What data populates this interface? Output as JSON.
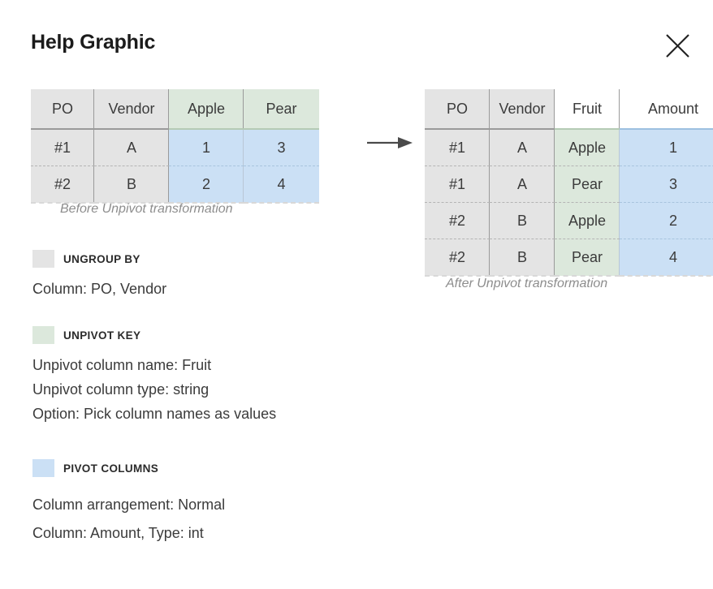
{
  "header": {
    "title": "Help Graphic",
    "close_label": "Close"
  },
  "before_table": {
    "caption": "Before Unpivot transformation",
    "columns": [
      {
        "label": "PO",
        "group": "ungroup"
      },
      {
        "label": "Vendor",
        "group": "ungroup"
      },
      {
        "label": "Apple",
        "group": "key"
      },
      {
        "label": "Pear",
        "group": "key"
      }
    ],
    "rows": [
      [
        "#1",
        "A",
        "1",
        "3"
      ],
      [
        "#2",
        "B",
        "2",
        "4"
      ]
    ]
  },
  "after_table": {
    "caption": "After Unpivot transformation",
    "columns": [
      {
        "label": "PO",
        "group": "ungroup"
      },
      {
        "label": "Vendor",
        "group": "ungroup"
      },
      {
        "label": "Fruit",
        "group": "key"
      },
      {
        "label": "Amount",
        "group": "pivot"
      }
    ],
    "rows": [
      [
        "#1",
        "A",
        "Apple",
        "1"
      ],
      [
        "#1",
        "A",
        "Pear",
        "3"
      ],
      [
        "#2",
        "B",
        "Apple",
        "2"
      ],
      [
        "#2",
        "B",
        "Pear",
        "4"
      ]
    ]
  },
  "transform_arrow": "arrow-right",
  "legend": [
    {
      "title": "UNGROUP BY",
      "color": "#e4e4e4",
      "lines": [
        "Column: PO, Vendor"
      ]
    },
    {
      "title": "UNPIVOT KEY",
      "color": "#dce8dc",
      "lines": [
        "Unpivot column name: Fruit",
        "Unpivot column type: string",
        "Option: Pick column names as values"
      ]
    },
    {
      "title": "PIVOT COLUMNS",
      "color": "#cbe0f5",
      "lines": [
        "Column arrangement: Normal",
        "Column: Amount, Type: int"
      ]
    }
  ]
}
